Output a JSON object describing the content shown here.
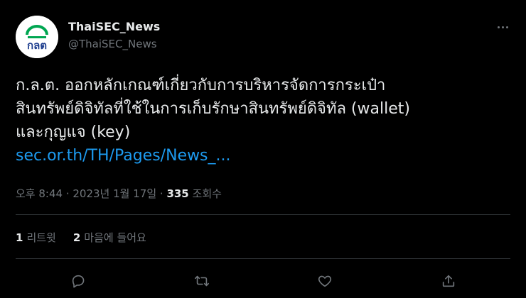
{
  "account": {
    "display_name": "ThaiSEC_News",
    "handle": "@ThaiSEC_News",
    "avatar_icon": "sec-thailand-logo",
    "avatar_text": "กลต"
  },
  "tweet": {
    "text_lines": [
      "ก.ล.ต. ออกหลักเกณฑ์เกี่ยวกับการบริหารจัดการกระเป๋า",
      "สินทรัพย์ดิจิทัลที่ใช้ในการเก็บรักษาสินทรัพย์ดิจิทัล (wallet)",
      "และกุญแจ (key)"
    ],
    "link_text": "sec.or.th/TH/Pages/News_..."
  },
  "meta": {
    "time": "오후 8:44",
    "separator": " · ",
    "date": "2023년 1월 17일",
    "views_count": "335",
    "views_label": "조회수"
  },
  "stats": {
    "retweets_count": "1",
    "retweets_label": "리트윗",
    "likes_count": "2",
    "likes_label": "마음에 들어요"
  },
  "actions": {
    "reply_icon": "reply-icon",
    "retweet_icon": "retweet-icon",
    "like_icon": "heart-icon",
    "share_icon": "share-icon"
  },
  "colors": {
    "background": "#000000",
    "text": "#e7e9ea",
    "secondary": "#71767b",
    "link": "#1d9bf0",
    "divider": "#2f3336",
    "brand_green": "#00a651",
    "brand_blue": "#1f3f8f"
  }
}
